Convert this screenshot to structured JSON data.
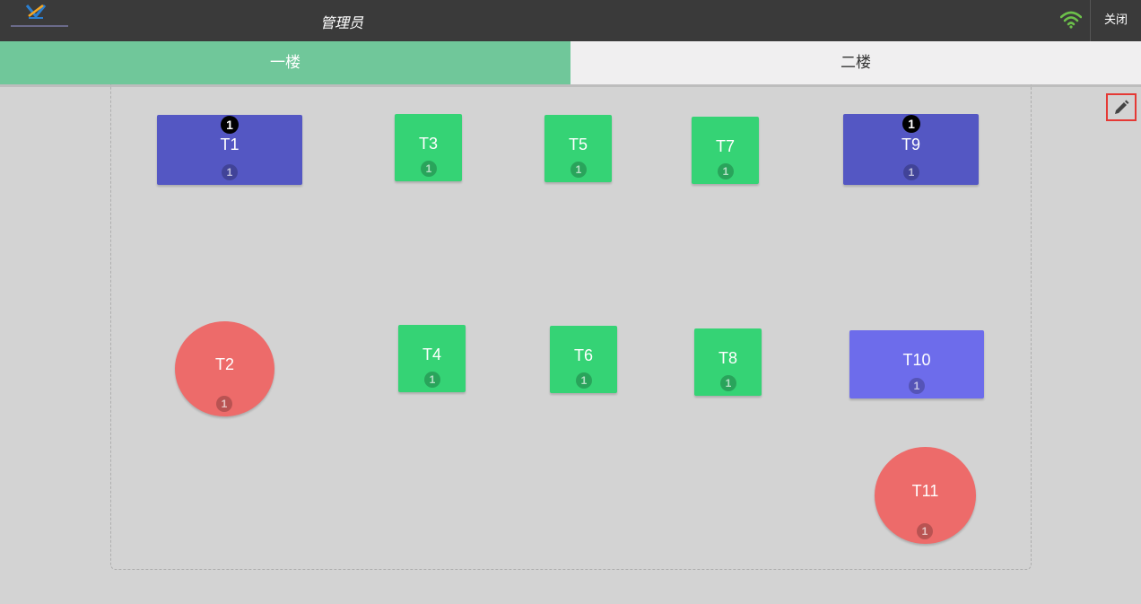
{
  "header": {
    "user_title": "管理员",
    "close_label": "关闭",
    "wifi_color": "#6cc04a"
  },
  "tabs": [
    {
      "label": "一楼",
      "active": true
    },
    {
      "label": "二楼",
      "active": false
    }
  ],
  "colors": {
    "occupied": "#5457c3",
    "free": "#35d375",
    "reserved": "#ed6b6a",
    "selected": "#6d6ceb"
  },
  "tables": [
    {
      "name": "T1",
      "seats": "1",
      "orders": "1"
    },
    {
      "name": "T3",
      "seats": "1"
    },
    {
      "name": "T5",
      "seats": "1"
    },
    {
      "name": "T7",
      "seats": "1"
    },
    {
      "name": "T9",
      "seats": "1",
      "orders": "1"
    },
    {
      "name": "T2",
      "seats": "1"
    },
    {
      "name": "T4",
      "seats": "1"
    },
    {
      "name": "T6",
      "seats": "1"
    },
    {
      "name": "T8",
      "seats": "1"
    },
    {
      "name": "T10",
      "seats": "1"
    },
    {
      "name": "T11",
      "seats": "1"
    }
  ]
}
